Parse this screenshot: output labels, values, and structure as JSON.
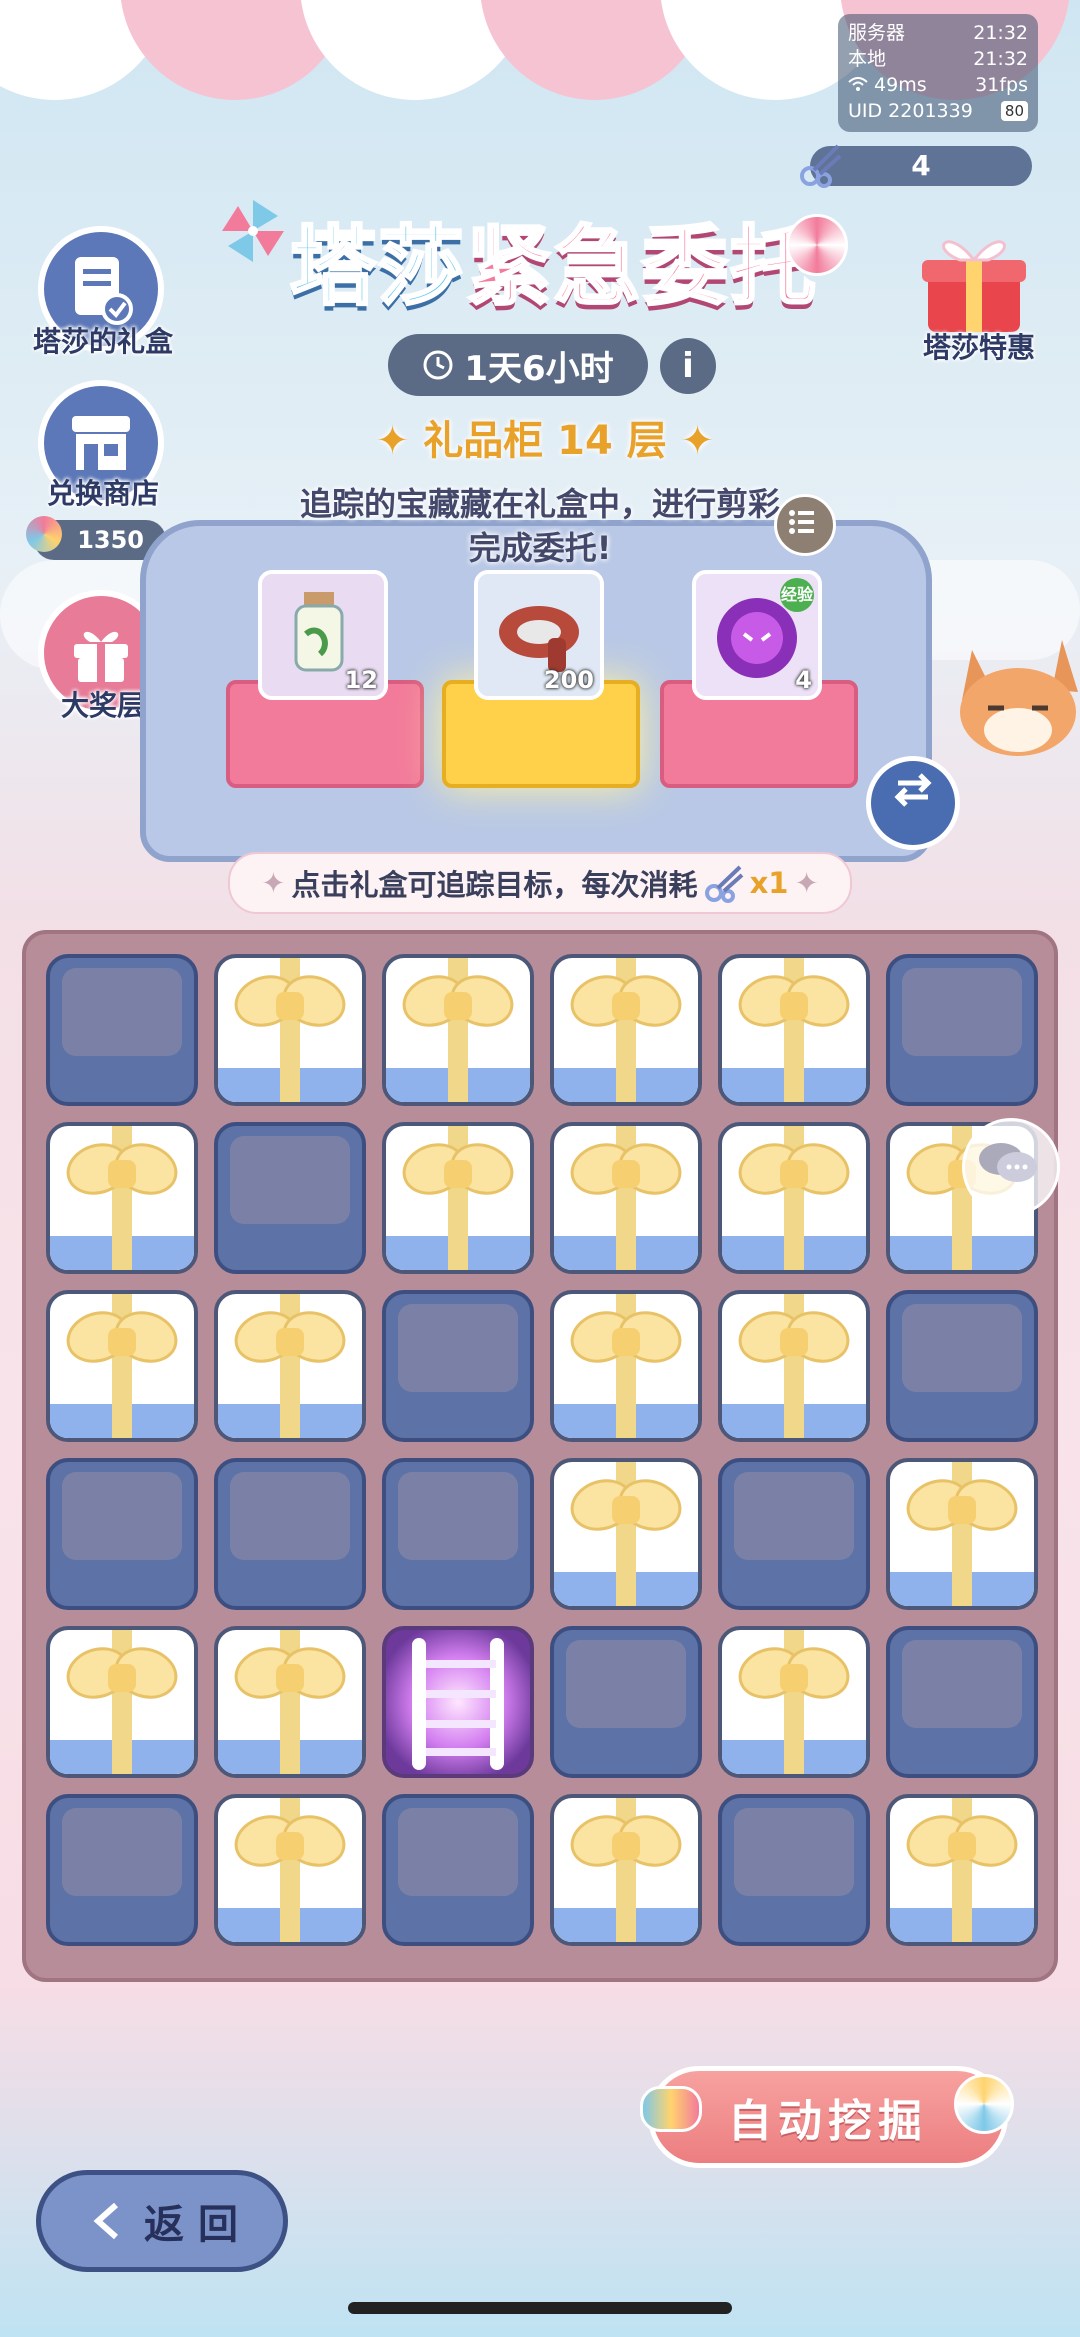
{
  "status": {
    "server_label": "服务器",
    "server_time": "21:32",
    "local_label": "本地",
    "local_time": "21:32",
    "ping": "49ms",
    "fps": "31fps",
    "uid": "UID 2201339",
    "battery": "80"
  },
  "scissors_count": "4",
  "left_buttons": {
    "gift_box_label": "塔莎的礼盒",
    "shop_label": "兑换商店",
    "candy_count": "1350",
    "grand_prize_label": "大奖层"
  },
  "right_button_label": "塔莎特惠",
  "title": {
    "part1": "塔莎",
    "part2": "紧急委托"
  },
  "timer": "1天6小时",
  "info_symbol": "i",
  "floor_text": "礼品柜 14 层",
  "description": "追踪的宝藏藏在礼盒中，进行剪彩完成委托!",
  "rewards": [
    {
      "icon": "bottle-icon",
      "count": "12"
    },
    {
      "icon": "scarf-icon",
      "count": "200"
    },
    {
      "icon": "exp-icon",
      "count": "4",
      "badge": "经验"
    }
  ],
  "hint_text": "点击礼盒可追踪目标，每次消耗",
  "hint_cost": "x1",
  "grid": [
    [
      "empty",
      "gift",
      "gift",
      "gift",
      "gift",
      "empty"
    ],
    [
      "gift",
      "empty",
      "gift",
      "gift",
      "gift",
      "gift"
    ],
    [
      "gift",
      "gift",
      "empty",
      "gift",
      "gift",
      "empty"
    ],
    [
      "empty",
      "empty",
      "empty",
      "gift",
      "empty",
      "gift"
    ],
    [
      "gift",
      "gift",
      "ladder",
      "empty",
      "gift",
      "empty"
    ],
    [
      "empty",
      "gift",
      "empty",
      "gift",
      "empty",
      "gift"
    ]
  ],
  "auto_dig_label": "自动挖掘",
  "back_label": "返 回",
  "colors": {
    "title_blue": "#62c6e9",
    "title_pink": "#f47a9f",
    "floor_gold": "#e8a22a",
    "board": "#b88d9a",
    "auto_button": "#ec7e80"
  }
}
